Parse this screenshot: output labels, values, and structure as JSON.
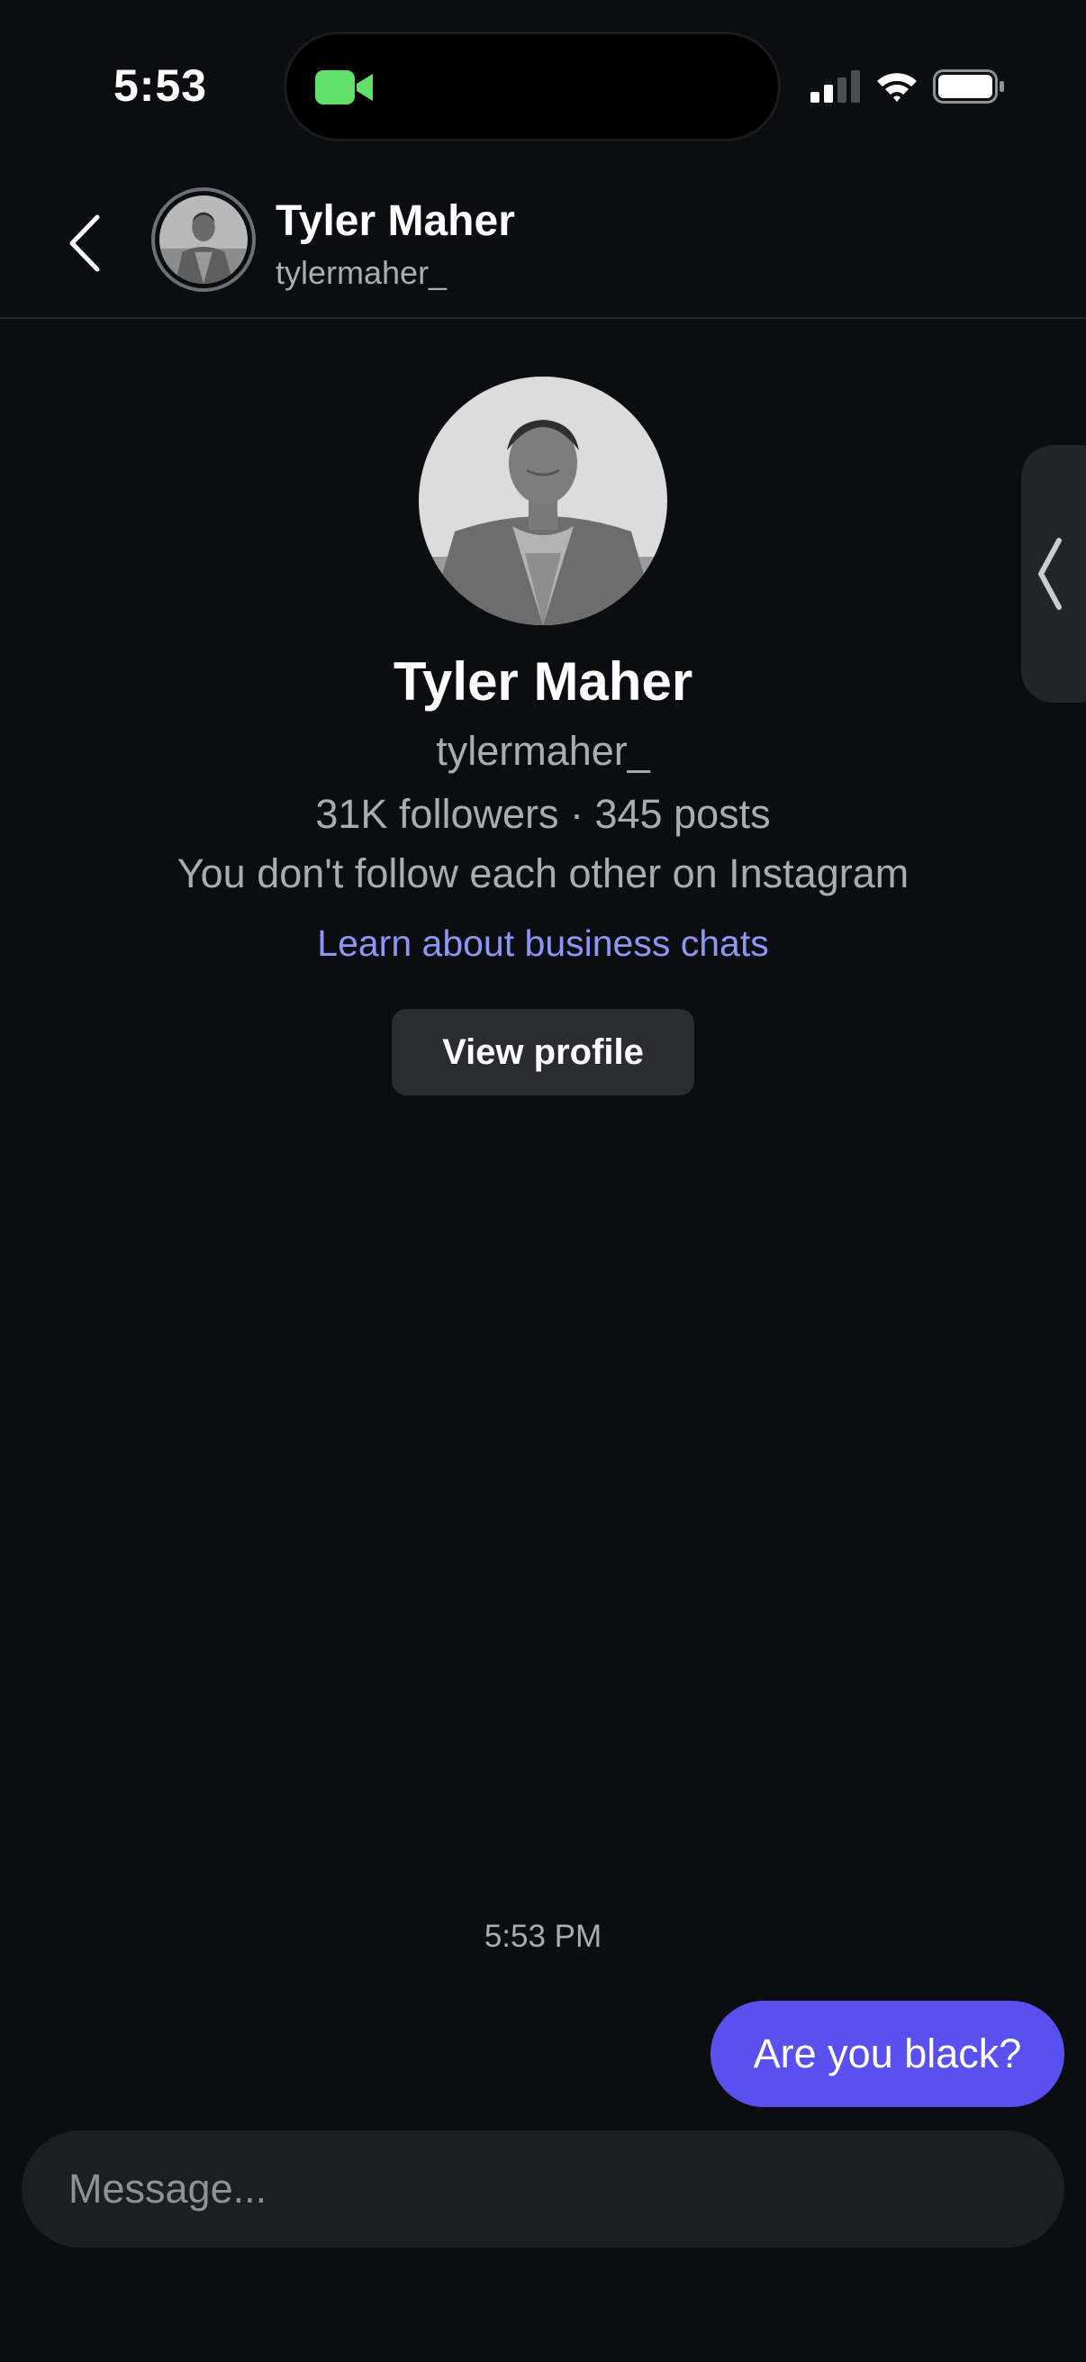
{
  "status_bar": {
    "time": "5:53",
    "icons": [
      "facetime-camera-icon",
      "cellular-signal-icon",
      "wifi-icon",
      "battery-icon"
    ],
    "camera_color": "#63e06b"
  },
  "header": {
    "back_icon": "chevron-left-icon",
    "name": "Tyler Maher",
    "username": "tylermaher_"
  },
  "side_handle": {
    "icon": "chevron-left-icon"
  },
  "profile": {
    "name": "Tyler Maher",
    "username": "tylermaher_",
    "stats": "31K followers · 345 posts",
    "relationship": "You don't follow each other on Instagram",
    "business_link": "Learn about business chats",
    "view_profile_label": "View profile"
  },
  "conversation": {
    "timestamp": "5:53 PM",
    "messages": [
      {
        "from": "me",
        "text": "Are you black?"
      }
    ]
  },
  "composer": {
    "placeholder": "Message..."
  },
  "colors": {
    "background": "#0b0d11",
    "bubble": "#5a50ef",
    "link": "#8e96f5",
    "secondary_text": "#a8acb3",
    "button": "#2a2c31"
  }
}
